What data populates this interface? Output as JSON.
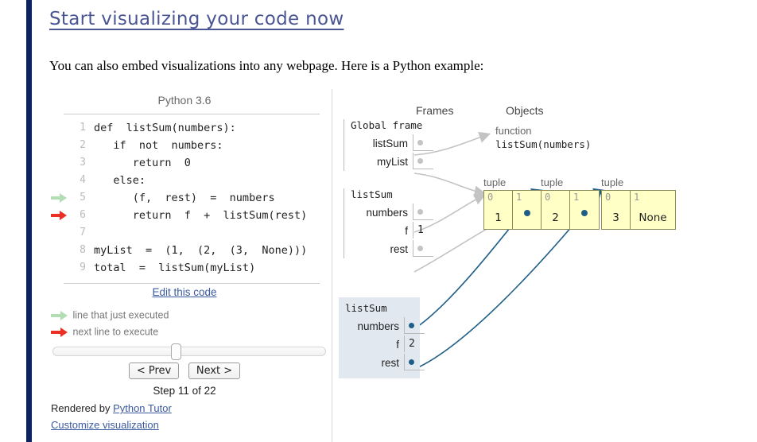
{
  "page": {
    "heading": "Start visualizing your code now",
    "intro": "You can also embed visualizations into any webpage. Here is a Python example:"
  },
  "code_panel": {
    "language_label": "Python 3.6",
    "edit_link": "Edit this code",
    "lines": [
      {
        "num": "1",
        "text": "def  listSum(numbers):",
        "marker": ""
      },
      {
        "num": "2",
        "text": "   if  not  numbers:",
        "marker": ""
      },
      {
        "num": "3",
        "text": "      return  0",
        "marker": ""
      },
      {
        "num": "4",
        "text": "   else:",
        "marker": ""
      },
      {
        "num": "5",
        "text": "      (f,  rest)  =  numbers",
        "marker": "green"
      },
      {
        "num": "6",
        "text": "      return  f  +  listSum(rest)",
        "marker": "red"
      },
      {
        "num": "7",
        "text": "",
        "marker": ""
      },
      {
        "num": "8",
        "text": "myList  =  (1,  (2,  (3,  None)))",
        "marker": ""
      },
      {
        "num": "9",
        "text": "total  =  listSum(myList)",
        "marker": ""
      }
    ],
    "legend": {
      "executed": "line that just executed",
      "next": "next line to execute"
    }
  },
  "controls": {
    "prev_label": "< Prev",
    "next_label": "Next >",
    "step_text": "Step 11 of 22",
    "rendered_by_prefix": "Rendered by ",
    "rendered_by_link": "Python Tutor",
    "customize_link": "Customize visualization",
    "slider_position_percent": 45
  },
  "diagram": {
    "frames_header": "Frames",
    "objects_header": "Objects",
    "frames": [
      {
        "title": "Global frame",
        "active": false,
        "vars": [
          {
            "name": "listSum",
            "kind": "pointer",
            "value": ""
          },
          {
            "name": "myList",
            "kind": "pointer",
            "value": ""
          }
        ]
      },
      {
        "title": "listSum",
        "active": false,
        "vars": [
          {
            "name": "numbers",
            "kind": "pointer",
            "value": ""
          },
          {
            "name": "f",
            "kind": "value",
            "value": "1"
          },
          {
            "name": "rest",
            "kind": "pointer",
            "value": ""
          }
        ]
      },
      {
        "title": "listSum",
        "active": true,
        "vars": [
          {
            "name": "numbers",
            "kind": "pointer",
            "value": ""
          },
          {
            "name": "f",
            "kind": "value",
            "value": "2"
          },
          {
            "name": "rest",
            "kind": "pointer",
            "value": ""
          }
        ]
      }
    ],
    "objects": [
      {
        "type": "function",
        "label": "function",
        "name": "listSum(numbers)"
      },
      {
        "type": "tuple",
        "label": "tuple",
        "cells": [
          {
            "index": "0",
            "value": "1",
            "is_pointer": false
          },
          {
            "index": "1",
            "value": "",
            "is_pointer": true
          }
        ]
      },
      {
        "type": "tuple",
        "label": "tuple",
        "cells": [
          {
            "index": "0",
            "value": "2",
            "is_pointer": false
          },
          {
            "index": "1",
            "value": "",
            "is_pointer": true
          }
        ]
      },
      {
        "type": "tuple",
        "label": "tuple",
        "cells": [
          {
            "index": "0",
            "value": "3",
            "is_pointer": false
          },
          {
            "index": "1",
            "value": "None",
            "is_pointer": false
          }
        ]
      }
    ]
  },
  "colors": {
    "navy_rail": "#0b2265",
    "heading_link": "#4a5694",
    "link": "#3b5aa0",
    "tuple_fill": "#ffffc6",
    "tuple_border": "#8a8a5a",
    "active_frame_bg": "#e2e8f0",
    "active_pointer": "#1f5f87",
    "inactive_pointer": "#c3c3c3",
    "executed_arrow": "#b3ddb3",
    "next_arrow": "#ec2f24"
  }
}
